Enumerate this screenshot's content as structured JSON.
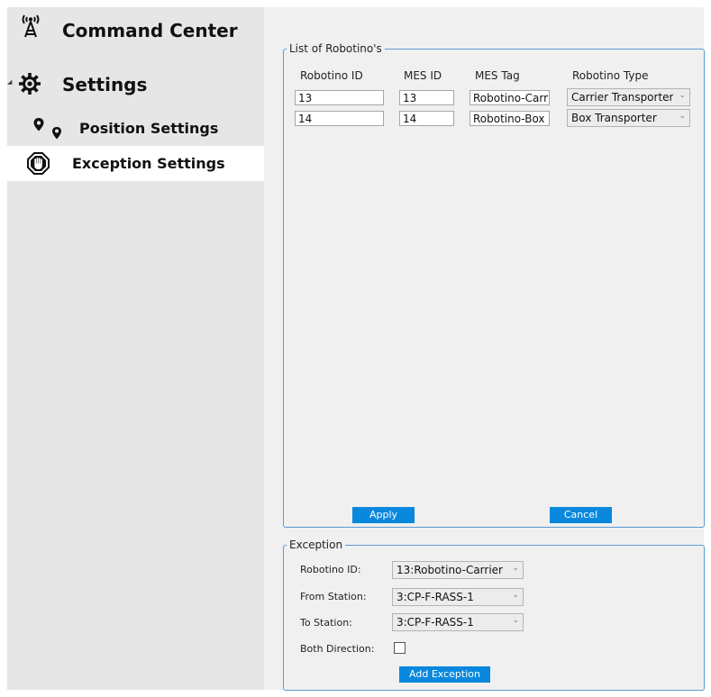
{
  "sidebar": {
    "items": [
      {
        "label": "Command Center",
        "icon": "antenna-tower-icon"
      },
      {
        "label": "Settings",
        "icon": "gear-icon",
        "expanded": true
      },
      {
        "label": "Position Settings",
        "icon": "location-pins-icon"
      },
      {
        "label": "Exception Settings",
        "icon": "stop-hand-icon",
        "selected": true
      }
    ]
  },
  "robotino_list": {
    "legend": "List of Robotino's",
    "headers": [
      "Robotino ID",
      "MES ID",
      "MES Tag",
      "Robotino Type"
    ],
    "rows": [
      {
        "robotino_id": "13",
        "mes_id": "13",
        "mes_tag": "Robotino-Carrier",
        "type": "Carrier Transporter"
      },
      {
        "robotino_id": "14",
        "mes_id": "14",
        "mes_tag": "Robotino-Box",
        "type": "Box Transporter"
      }
    ],
    "apply_label": "Apply",
    "cancel_label": "Cancel"
  },
  "exception": {
    "legend": "Exception",
    "robotino_id_label": "Robotino ID:",
    "robotino_id_value": "13:Robotino-Carrier",
    "from_station_label": "From Station:",
    "from_station_value": "3:CP-F-RASS-1",
    "to_station_label": "To Station:",
    "to_station_value": "3:CP-F-RASS-1",
    "both_direction_label": "Both Direction:",
    "both_direction_checked": false,
    "add_label": "Add Exception"
  },
  "colors": {
    "accent": "#0a88dd",
    "group_border": "#5b9bd5",
    "sidebar_bg": "#e6e6e6",
    "selected_bg": "#ffffff",
    "content_bg": "#f0f0f0"
  }
}
